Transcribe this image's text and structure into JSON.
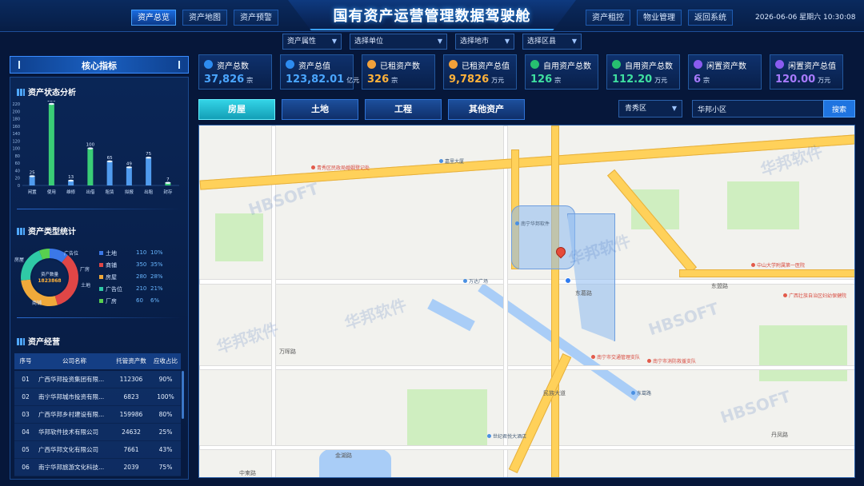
{
  "header": {
    "title": "国有资产运营管理数据驾驶舱",
    "nav_left": [
      {
        "label": "资产总览",
        "active": true
      },
      {
        "label": "资产地图",
        "active": false
      },
      {
        "label": "资产预警",
        "active": false
      }
    ],
    "nav_right": [
      {
        "label": "资产租控"
      },
      {
        "label": "物业管理"
      },
      {
        "label": "返回系统"
      }
    ],
    "datetime": "2026-06-06 星期六 10:30:08"
  },
  "filters": [
    {
      "label": "资产属性"
    },
    {
      "label": "选择单位"
    },
    {
      "label": "选择地市"
    },
    {
      "label": "选择区县"
    }
  ],
  "left": {
    "panel_title": "核心指标",
    "status_title": "资产状态分析",
    "type_title": "资产类型统计",
    "ops_title": "资产经营"
  },
  "chart_data": [
    {
      "type": "bar",
      "categories": [
        "闲置",
        "使用",
        "维修",
        "出借",
        "租赁",
        "拟报",
        "出租",
        "封存"
      ],
      "values": [
        25,
        220,
        13,
        100,
        65,
        49,
        75,
        7
      ],
      "ylim": [
        0,
        220
      ],
      "yticks": [
        0,
        20,
        40,
        60,
        80,
        100,
        120,
        140,
        160,
        180,
        200,
        220
      ],
      "grid": false,
      "colors": [
        "#58a8ff",
        "#3fe07a",
        "#58a8ff",
        "#3fe07a",
        "#58a8ff",
        "#58a8ff",
        "#58a8ff",
        "#3fe07a"
      ]
    },
    {
      "type": "pie",
      "center_label": "资产数量",
      "center_value": "1823868",
      "slices": [
        {
          "name": "土地",
          "value": 110,
          "pct": "10%",
          "color": "#3b78e8"
        },
        {
          "name": "商铺",
          "value": 350,
          "pct": "35%",
          "color": "#e04646"
        },
        {
          "name": "房屋",
          "value": 280,
          "pct": "28%",
          "color": "#f0a93a"
        },
        {
          "name": "广告位",
          "value": 210,
          "pct": "21%",
          "color": "#2fc9a6"
        },
        {
          "name": "厂房",
          "value": 60,
          "pct": "6%",
          "color": "#58d04f"
        }
      ]
    }
  ],
  "table": {
    "headers": [
      "序号",
      "公司名称",
      "托管资产数",
      "应收占比"
    ],
    "rows": [
      [
        "01",
        "广西华邦投资集团有限...",
        "112306",
        "90%"
      ],
      [
        "02",
        "南宁华邦城市投资有限...",
        "6823",
        "100%"
      ],
      [
        "03",
        "广西华邦乡村建设有限...",
        "159986",
        "80%"
      ],
      [
        "04",
        "华邦软件技术有限公司",
        "24632",
        "25%"
      ],
      [
        "05",
        "广西华邦文化有限公司",
        "7661",
        "43%"
      ],
      [
        "06",
        "南宁华邦旅游文化科技...",
        "2039",
        "75%"
      ]
    ]
  },
  "kpis": [
    {
      "label": "资产总数",
      "value": "37,826",
      "unit": "宗",
      "color": "#4aa6ff",
      "icon": "blue"
    },
    {
      "label": "资产总值",
      "value": "123,82.01",
      "unit": "亿元",
      "color": "#4aa6ff",
      "icon": "blue"
    },
    {
      "label": "已租资产数",
      "value": "326",
      "unit": "宗",
      "color": "#ffb23a",
      "icon": "orange"
    },
    {
      "label": "已租资产总值",
      "value": "9,7826",
      "unit": "万元",
      "color": "#ffb23a",
      "icon": "orange"
    },
    {
      "label": "自用资产总数",
      "value": "126",
      "unit": "宗",
      "color": "#3fe0a0",
      "icon": "green"
    },
    {
      "label": "自用资产总数",
      "value": "112.20",
      "unit": "万元",
      "color": "#3fe0a0",
      "icon": "green"
    },
    {
      "label": "闲置资产数",
      "value": "6",
      "unit": "宗",
      "color": "#a97bff",
      "icon": "purple"
    },
    {
      "label": "闲置资产总值",
      "value": "120.00",
      "unit": "万元",
      "color": "#a97bff",
      "icon": "purple"
    }
  ],
  "categories": [
    {
      "label": "房屋",
      "active": true
    },
    {
      "label": "土地",
      "active": false
    },
    {
      "label": "工程",
      "active": false
    },
    {
      "label": "其他资产",
      "active": false
    }
  ],
  "search": {
    "district": "青秀区",
    "value": "华邦小区",
    "button": "搜索"
  },
  "map": {
    "roads": [
      "东葛路",
      "万晖路",
      "民族大道",
      "金湖路",
      "丹凤路",
      "中柬路",
      "东盟路"
    ],
    "pois": [
      {
        "t": "青秀区民政局婚姻登记处",
        "red": true
      },
      {
        "t": "南宁华邦软件",
        "red": false
      },
      {
        "t": "嘉里大厦",
        "red": false
      },
      {
        "t": "万达广场",
        "red": false
      },
      {
        "t": "中山大学附属第一医院",
        "red": true
      },
      {
        "t": "广西壮族自治区妇幼保健院",
        "red": true
      },
      {
        "t": "南宁市交通管理支队",
        "red": true
      },
      {
        "t": "南宁市消防救援支队",
        "red": true
      },
      {
        "t": "世纪君悦大酒店",
        "red": false
      },
      {
        "t": "东葛路",
        "red": false
      }
    ],
    "watermarks": [
      "华邦软件",
      "HBSOFT"
    ]
  }
}
